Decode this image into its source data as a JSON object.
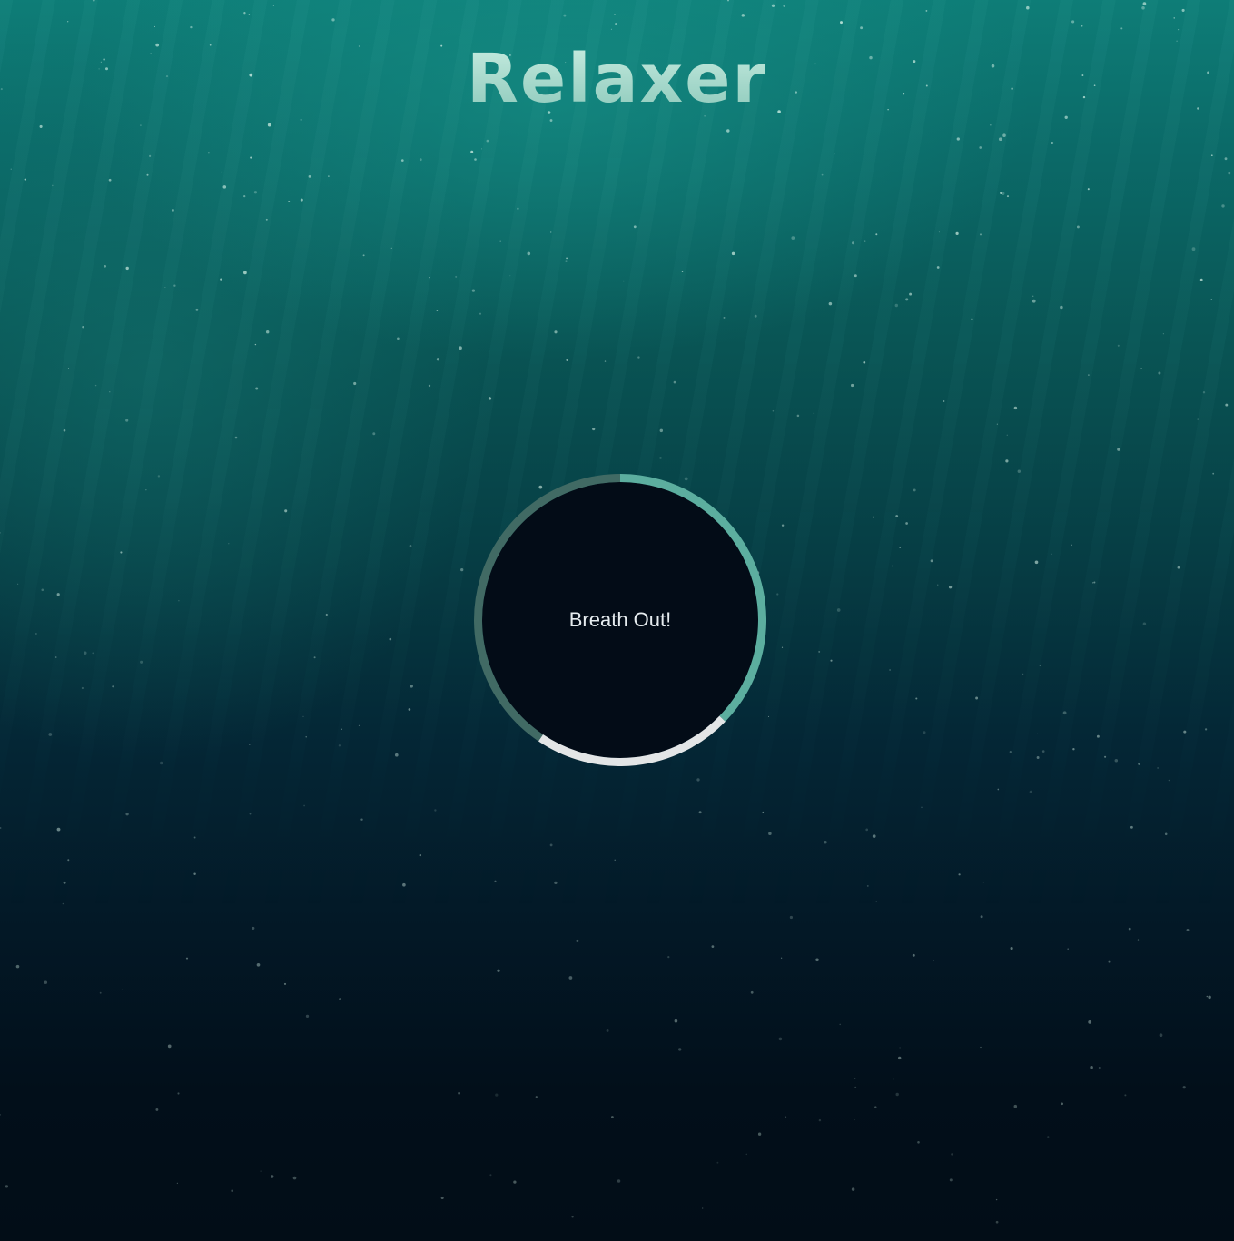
{
  "app": {
    "title": "Relaxer"
  },
  "breathing": {
    "instruction": "Breath Out!",
    "colors": {
      "inner": "#030c17",
      "breathe_in_arc": "#5cae9f",
      "hold_arc": "#e3e5e6",
      "breathe_out_arc": "#416a64"
    }
  }
}
